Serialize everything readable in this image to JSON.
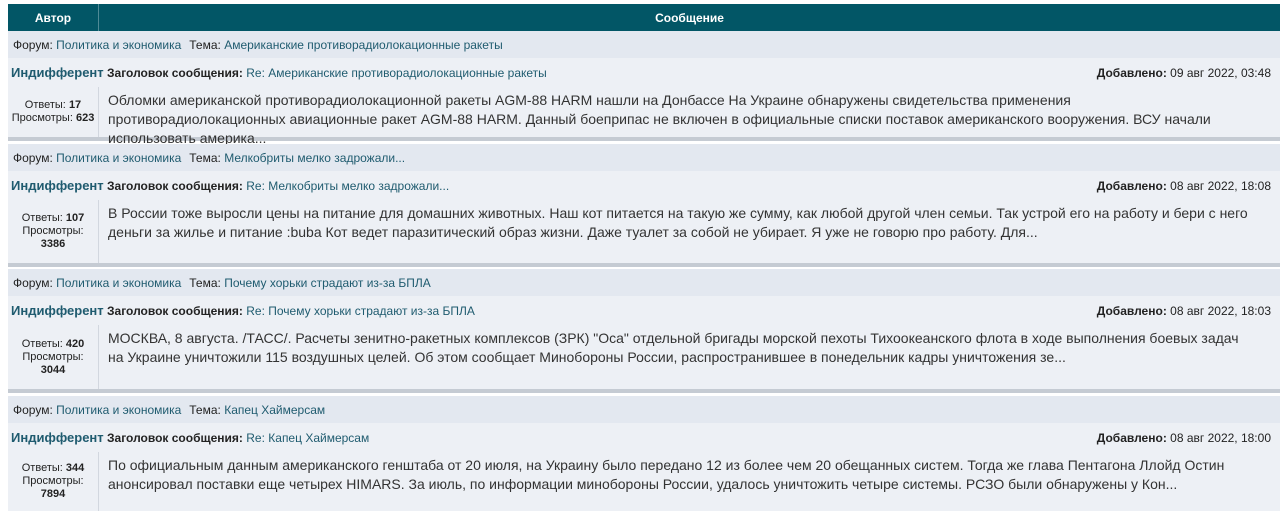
{
  "header": {
    "author": "Автор",
    "message": "Сообщение"
  },
  "labels": {
    "forum": "Форум:",
    "topic": "Тема:",
    "subject": "Заголовок сообщения:",
    "added": "Добавлено:",
    "replies": "Ответы:",
    "views": "Просмотры:"
  },
  "posts": [
    {
      "forum": "Политика и экономика",
      "topic": "Американские противорадиолокационные ракеты",
      "author": "Индифферент",
      "subject": "Re: Американские противорадиолокационные ракеты",
      "date": "09 авг 2022, 03:48",
      "replies": "17",
      "views": "623",
      "text": "Обломки американской противорадиолокационной ракеты AGM-88 HARM нашли на Донбассе На Украине обнаружены свидетельства применения противорадиолокационных авиационные ракет AGM-88 HARM. Данный боеприпас не включен в официальные списки поставок американского вооружения. ВСУ начали использовать америка..."
    },
    {
      "forum": "Политика и экономика",
      "topic": "Мелкобриты мелко задрожали...",
      "author": "Индифферент",
      "subject": "Re: Мелкобриты мелко задрожали...",
      "date": "08 авг 2022, 18:08",
      "replies": "107",
      "views": "3386",
      "text": "В России тоже выросли цены на питание для домашних животных. Наш кот питается на такую же сумму, как любой другой член семьи. Так устрой его на работу и бери с него деньги за жилье и питание :buba Кот ведет паразитический образ жизни. Даже туалет за собой не убирает. Я уже не говорю про работу. Для..."
    },
    {
      "forum": "Политика и экономика",
      "topic": "Почему хорьки страдают из-за БПЛА",
      "author": "Индифферент",
      "subject": "Re: Почему хорьки страдают из-за БПЛА",
      "date": "08 авг 2022, 18:03",
      "replies": "420",
      "views": "3044",
      "text": "МОСКВА, 8 августа. /ТАСС/. Расчеты зенитно-ракетных комплексов (ЗРК) \"Оса\" отдельной бригады морской пехоты Тихоокеанского флота в ходе выполнения боевых задач на Украине уничтожили 115 воздушных целей. Об этом сообщает Минобороны России, распространившее в понедельник кадры уничтожения зе..."
    },
    {
      "forum": "Политика и экономика",
      "topic": "Капец Хаймерсам",
      "author": "Индифферент",
      "subject": "Re: Капец Хаймерсам",
      "date": "08 авг 2022, 18:00",
      "replies": "344",
      "views": "7894",
      "text": "По официальным данным американского генштаба от 20 июля, на Украину было передано 12 из более чем 20 обещанных систем. Тогда же глава Пентагона Ллойд Остин анонсировал поставки еще четырех HIMARS. За июль, по информации минобороны России, удалось уничтожить четыре системы. РСЗО были обнаружены у Кон..."
    }
  ]
}
